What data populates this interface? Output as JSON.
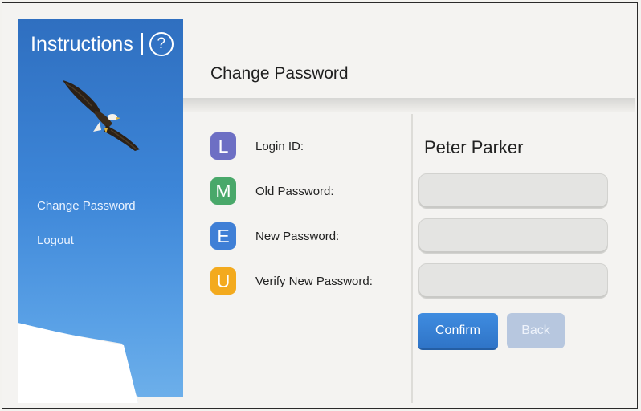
{
  "sidebar": {
    "instructions_label": "Instructions",
    "help_glyph": "?",
    "nav_items": [
      {
        "label": "Change Password"
      },
      {
        "label": "Logout"
      }
    ],
    "gradient_colors": [
      "#2f6fc0",
      "#6eb0ea"
    ]
  },
  "main": {
    "page_title": "Change Password",
    "rows": [
      {
        "letter": "L",
        "color": "#6d6fc4",
        "label": "Login ID:"
      },
      {
        "letter": "M",
        "color": "#49a86a",
        "label": "Old Password:"
      },
      {
        "letter": "E",
        "color": "#3f7fd6",
        "label": "New Password:"
      },
      {
        "letter": "U",
        "color": "#f3aa1e",
        "label": "Verify New Password:"
      }
    ],
    "login_value": "Peter Parker",
    "old_password": {
      "value": "",
      "placeholder": ""
    },
    "new_password": {
      "value": "",
      "placeholder": ""
    },
    "verify_password": {
      "value": "",
      "placeholder": ""
    },
    "confirm_label": "Confirm",
    "back_label": "Back"
  }
}
